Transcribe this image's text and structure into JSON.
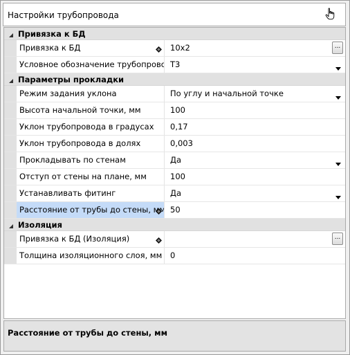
{
  "window": {
    "title": "Настройки трубопровода"
  },
  "grid": {
    "categories": [
      {
        "label": "Привязка к БД",
        "rows": [
          {
            "name": "Привязка к БД",
            "value": "10x2",
            "diamond": true,
            "editor": "ellipsis",
            "ellipsis_label": "..."
          },
          {
            "name": "Условное обозначение трубопровода",
            "value": "T3",
            "diamond": false,
            "editor": "dropdown"
          }
        ]
      },
      {
        "label": "Параметры прокладки",
        "rows": [
          {
            "name": "Режим задания уклона",
            "value": "По углу и начальной точке",
            "editor": "dropdown"
          },
          {
            "name": "Высота начальной точки, мм",
            "value": "100",
            "editor": "text"
          },
          {
            "name": "Уклон трубопровода в градусах",
            "value": "0,17",
            "editor": "text"
          },
          {
            "name": "Уклон трубопровода в долях",
            "value": "0,003",
            "editor": "text"
          },
          {
            "name": "Прокладывать по стенам",
            "value": "Да",
            "editor": "dropdown"
          },
          {
            "name": "Отступ от стены на плане, мм",
            "value": "100",
            "editor": "text"
          },
          {
            "name": "Устанавливать фитинг",
            "value": "Да",
            "editor": "dropdown"
          },
          {
            "name": "Расстояние от трубы до стены, мм",
            "value": "50",
            "diamond": true,
            "editor": "text",
            "selected": true
          }
        ]
      },
      {
        "label": "Изоляция",
        "rows": [
          {
            "name": "Привязка к БД (Изоляция)",
            "value": "",
            "diamond": true,
            "editor": "ellipsis",
            "ellipsis_label": "..."
          },
          {
            "name": "Толщина изоляционного слоя, мм",
            "value": "0",
            "editor": "text"
          }
        ]
      }
    ]
  },
  "description": {
    "text": "Расстояние от трубы до стены, мм"
  },
  "icons": {
    "title_button": "hand-pointer-icon",
    "collapse": "collapse-triangle-icon",
    "dropdown": "dropdown-arrow-icon",
    "bind": "diamond-icon"
  },
  "colors": {
    "selected_row": "#c4dbf8",
    "category_bg": "#e1e1e1"
  }
}
